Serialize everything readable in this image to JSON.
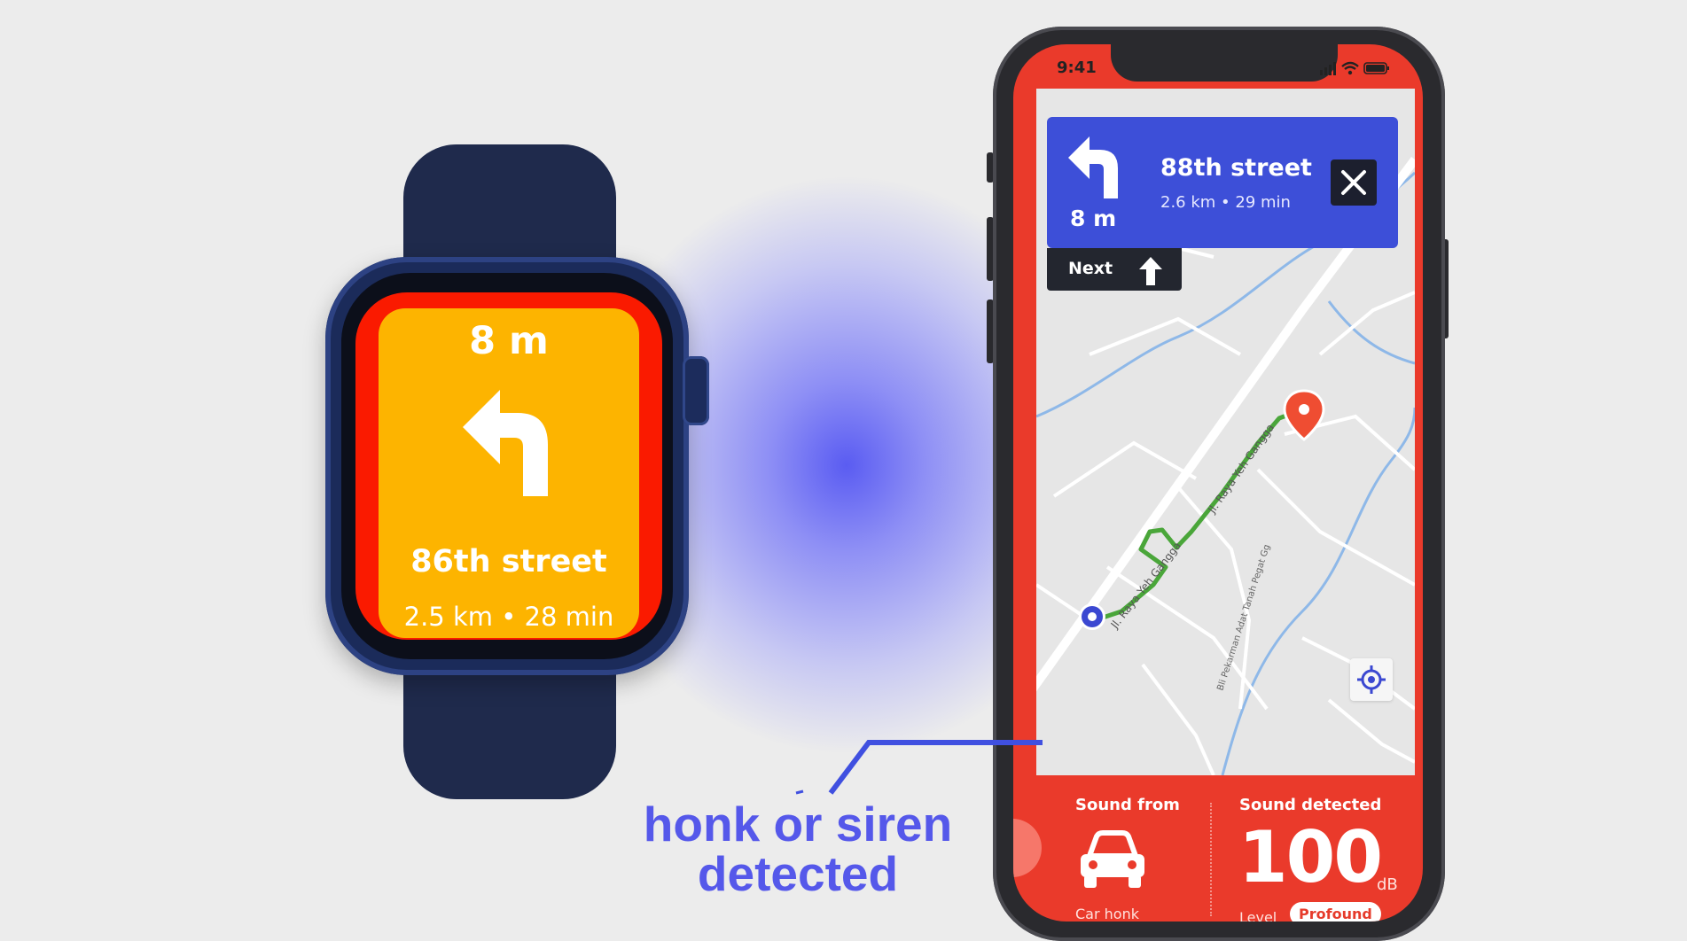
{
  "watch": {
    "distance": "8 m",
    "street": "86th street",
    "meta": "2.5 km • 28 min",
    "turn_icon": "turn-left-arrow-icon",
    "alert_color": "#fa1a00",
    "screen_color": "#fdb400"
  },
  "phone": {
    "status_time": "9:41",
    "nav": {
      "distance": "8 m",
      "street": "88th street",
      "meta": "2.6 km • 29 min",
      "next_label": "Next",
      "color": "#3d4fd8"
    },
    "map": {
      "roads": [
        "Jl. Raya Yeh Gangga",
        "Jl. Raya Yeh Gangga",
        "Bli Pekarman Adat Tanah Pegat Gg"
      ]
    },
    "sound": {
      "from_label": "Sound from",
      "source": "Car honk",
      "detected_label": "Sound detected",
      "value": "100",
      "unit": "dB",
      "level_label": "Level",
      "level": "Profound",
      "color": "#ea3a2b"
    }
  },
  "callout": {
    "line1": "honk or siren",
    "line2": "detected",
    "color": "#5558ea"
  }
}
